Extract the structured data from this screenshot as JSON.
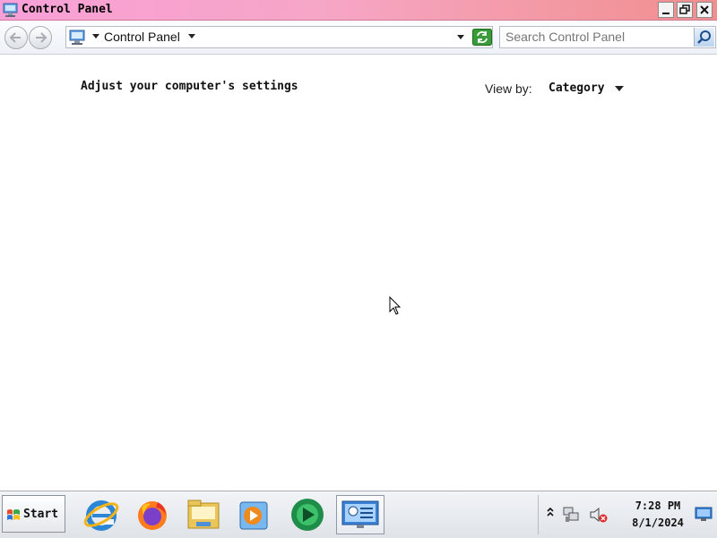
{
  "window": {
    "title": "Control Panel",
    "title_gradient": [
      "#f9a0d8",
      "#f18e8e"
    ]
  },
  "address_bar": {
    "location": "Control Panel"
  },
  "search": {
    "placeholder": "Search Control Panel"
  },
  "content": {
    "heading": "Adjust your computer's settings",
    "view_by_label": "View by:",
    "view_by_value": "Category"
  },
  "taskbar": {
    "start_label": "Start",
    "apps": [
      {
        "name": "internet-explorer-icon"
      },
      {
        "name": "firefox-icon"
      },
      {
        "name": "file-explorer-icon"
      },
      {
        "name": "media-player-icon"
      },
      {
        "name": "media-center-icon"
      },
      {
        "name": "control-panel-icon",
        "active": true
      }
    ],
    "clock": {
      "time": "7:28 PM",
      "date": "8/1/2024"
    }
  }
}
